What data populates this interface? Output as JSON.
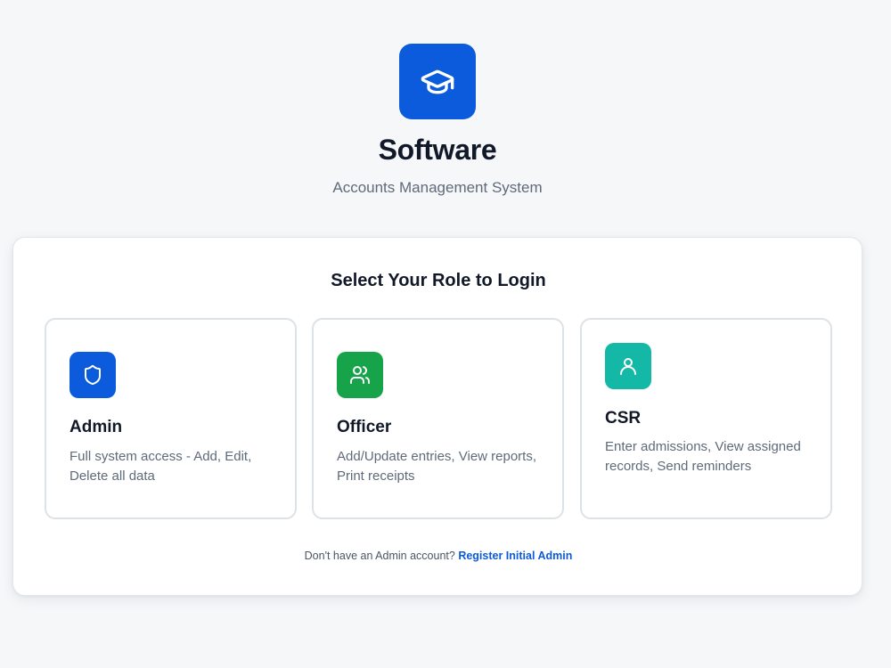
{
  "app": {
    "name": "Software",
    "subtitle": "Accounts Management System",
    "logo_icon": "graduation-cap-icon",
    "brand_color": "#0b5bdc"
  },
  "login": {
    "title": "Select Your Role to Login",
    "roles": [
      {
        "name": "Admin",
        "description": "Full system access - Add, Edit, Delete all data",
        "icon": "shield-icon",
        "color": "#0b5bdc"
      },
      {
        "name": "Officer",
        "description": "Add/Update entries, View reports, Print receipts",
        "icon": "users-icon",
        "color": "#16a34a"
      },
      {
        "name": "CSR",
        "description": "Enter admissions, View assigned records, Send reminders",
        "icon": "user-icon",
        "color": "#14b8a6"
      }
    ],
    "footer_text": "Don't have an Admin account?",
    "footer_link": "Register Initial Admin"
  }
}
